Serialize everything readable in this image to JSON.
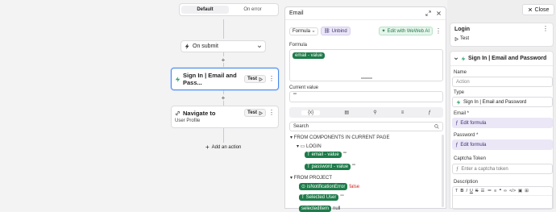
{
  "canvas": {
    "segment": {
      "default": "Default",
      "on_error": "On error"
    },
    "trigger": {
      "label": "On submit"
    },
    "action1": {
      "title": "Sign In | Email and Pass...",
      "test": "Test"
    },
    "action2": {
      "title": "Navigate to",
      "subtitle": "User Profile",
      "test": "Test"
    },
    "add_action": "Add an action"
  },
  "popup": {
    "title": "Email",
    "mode": "Formula",
    "unbind": "Unbind",
    "ai": "Edit with WeWeb AI",
    "formula_label": "Formula",
    "formula_token": "email - value",
    "current_value_label": "Current value",
    "current_value": "\"\"",
    "search_placeholder": "Search",
    "section1": "FROM COMPONENTS IN CURRENT PAGE",
    "login_group": "LOGIN",
    "email_value": "email - value",
    "email_value_result": "\"\"",
    "password_value": "password - value",
    "password_value_result": "\"\"",
    "section2": "FROM PROJECT",
    "notif_error": "isNotificationError",
    "notif_error_result": "false",
    "selected_user": "Selected User",
    "selected_user_result": "\"\"",
    "selected_item": "selectedItem",
    "selected_item_result": "null"
  },
  "right": {
    "close": "Close",
    "login_title": "Login",
    "login_test": "Test",
    "panel_title": "Sign In | Email and Password",
    "name_label": "Name",
    "name_placeholder": "Action",
    "type_label": "Type",
    "type_value": "Sign In | Email and Password",
    "email_label": "Email *",
    "email_field": "Edit formula",
    "password_label": "Password *",
    "password_field": "Edit formula",
    "captcha_label": "Captcha Token",
    "captcha_placeholder": "Enter a captcha token",
    "description_label": "Description"
  },
  "colors": {
    "accent": "#4b8ae8",
    "green": "#1e7b4a",
    "purple_bg": "#ebe7f6",
    "error": "#d0271f"
  }
}
